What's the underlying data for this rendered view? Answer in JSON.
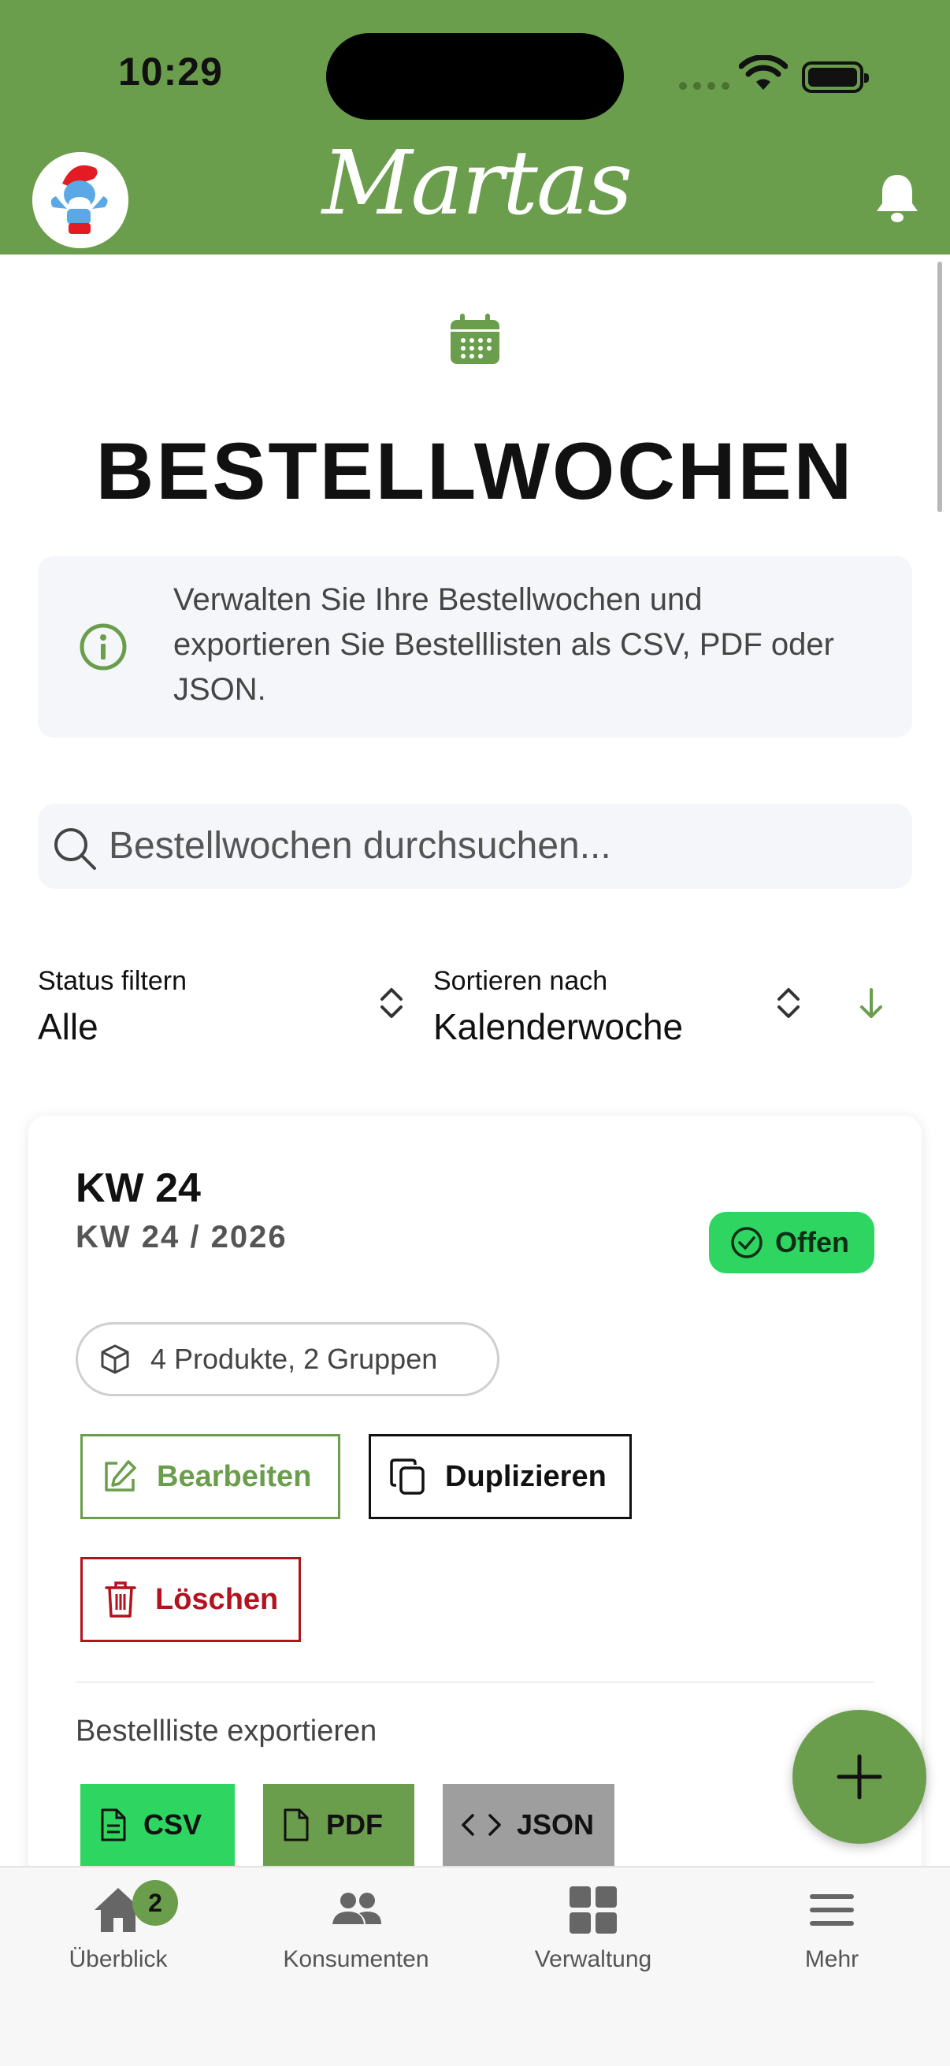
{
  "status_bar": {
    "time": "10:29"
  },
  "header": {
    "logo_text": "Martas",
    "avatar_icon": "smurf-avatar",
    "notification_icon": "bell-icon"
  },
  "page": {
    "title": "BESTELLWOCHEN",
    "title_icon": "calendar-icon",
    "info_text": "Verwalten Sie Ihre Bestellwochen und exportieren Sie Bestelllisten als CSV, PDF oder JSON."
  },
  "search": {
    "placeholder": "Bestellwochen durchsuchen...",
    "value": ""
  },
  "filters": {
    "status_label": "Status filtern",
    "status_value": "Alle",
    "sort_label": "Sortieren nach",
    "sort_value": "Kalenderwoche",
    "sort_direction": "descending"
  },
  "card": {
    "title": "KW 24",
    "subtitle": "KW 24 / 2026",
    "status": "Offen",
    "summary": "4 Produkte, 2 Gruppen",
    "actions": {
      "edit": "Bearbeiten",
      "duplicate": "Duplizieren",
      "delete": "Löschen"
    },
    "export_label": "Bestellliste exportieren",
    "exports": {
      "csv": "CSV",
      "pdf": "PDF",
      "json": "JSON"
    }
  },
  "fab": {
    "icon": "plus-icon"
  },
  "tabbar": {
    "items": [
      {
        "label": "Überblick",
        "icon": "home-icon",
        "badge": "2"
      },
      {
        "label": "Konsumenten",
        "icon": "users-icon"
      },
      {
        "label": "Verwaltung",
        "icon": "grid-icon"
      },
      {
        "label": "Mehr",
        "icon": "menu-icon"
      }
    ]
  },
  "colors": {
    "brand_green": "#6b9e4c",
    "status_green": "#2fd561",
    "danger_red": "#b3121f",
    "json_grey": "#9e9e9e"
  }
}
